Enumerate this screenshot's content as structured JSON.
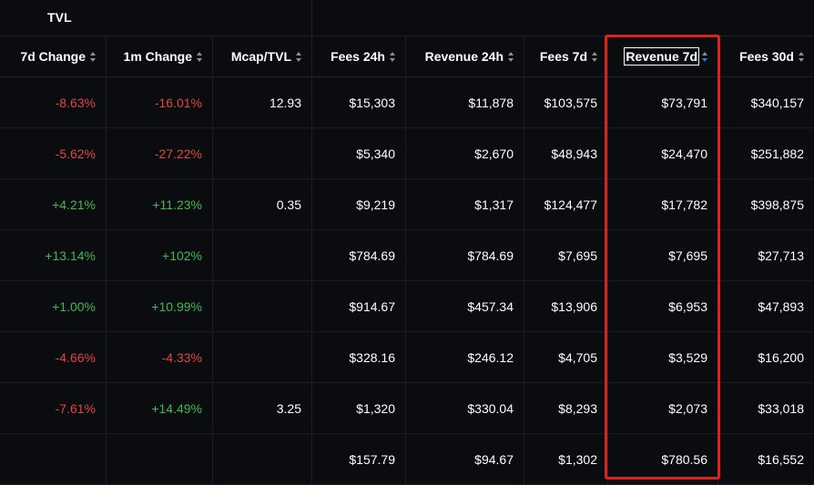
{
  "group_header": {
    "tvl_label": "TVL"
  },
  "columns": [
    {
      "key": "change_7d",
      "label": "7d Change"
    },
    {
      "key": "change_1m",
      "label": "1m Change"
    },
    {
      "key": "mcap_tvl",
      "label": "Mcap/TVL"
    },
    {
      "key": "fees_24h",
      "label": "Fees 24h"
    },
    {
      "key": "revenue_24h",
      "label": "Revenue 24h"
    },
    {
      "key": "fees_7d",
      "label": "Fees 7d"
    },
    {
      "key": "revenue_7d",
      "label": "Revenue 7d",
      "sorted": "desc"
    },
    {
      "key": "fees_30d",
      "label": "Fees 30d"
    }
  ],
  "rows": [
    [
      "-8.63%",
      "-16.01%",
      "12.93",
      "$15,303",
      "$11,878",
      "$103,575",
      "$73,791",
      "$340,157"
    ],
    [
      "-5.62%",
      "-27.22%",
      "",
      "$5,340",
      "$2,670",
      "$48,943",
      "$24,470",
      "$251,882"
    ],
    [
      "+4.21%",
      "+11.23%",
      "0.35",
      "$9,219",
      "$1,317",
      "$124,477",
      "$17,782",
      "$398,875"
    ],
    [
      "+13.14%",
      "+102%",
      "",
      "$784.69",
      "$784.69",
      "$7,695",
      "$7,695",
      "$27,713"
    ],
    [
      "+1.00%",
      "+10.99%",
      "",
      "$914.67",
      "$457.34",
      "$13,906",
      "$6,953",
      "$47,893"
    ],
    [
      "-4.66%",
      "-4.33%",
      "",
      "$328.16",
      "$246.12",
      "$4,705",
      "$3,529",
      "$16,200"
    ],
    [
      "-7.61%",
      "+14.49%",
      "3.25",
      "$1,320",
      "$330.04",
      "$8,293",
      "$2,073",
      "$33,018"
    ],
    [
      "",
      "",
      "",
      "$157.79",
      "$94.67",
      "$1,302",
      "$780.56",
      "$16,552"
    ]
  ],
  "colors": {
    "background": "#0b0c0f",
    "negative": "#e0463e",
    "positive": "#3fb950",
    "highlight_border": "#e0201c",
    "sort_active": "#2f7ae5"
  },
  "icons": {
    "sort": "sort-arrows-icon"
  }
}
